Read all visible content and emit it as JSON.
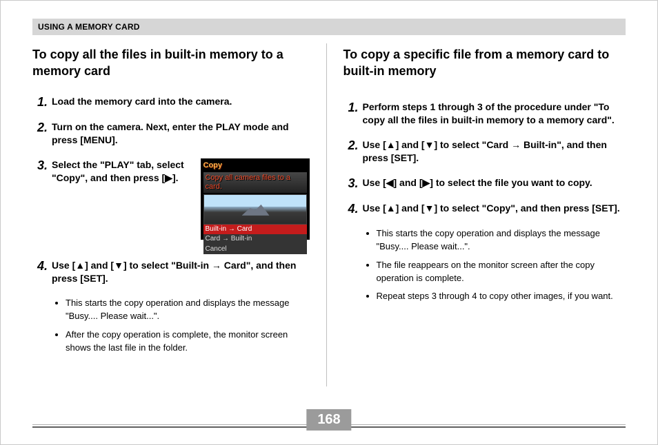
{
  "section_bar": "USING A MEMORY CARD",
  "page_number": "168",
  "left": {
    "heading": "To copy all the files in built-in memory to a memory card",
    "steps": {
      "s1": "Load the memory card into the camera.",
      "s2": "Turn on the camera. Next, enter the PLAY mode and press [MENU].",
      "s3": "Select the \"PLAY\" tab, select \"Copy\", and then press [▶].",
      "s4": "Use [▲] and [▼] to select \"Built-in → Card\", and then press [SET]."
    },
    "s4_sub": [
      "This starts the copy operation and displays the message \"Busy.... Please wait...\".",
      "After the copy operation is complete, the monitor screen shows the last file in the folder."
    ],
    "lcd": {
      "title": "Copy",
      "subtitle": "Copy all camera files to a card.",
      "menu_sel": "Built-in → Card",
      "menu_row1": "Card → Built-in",
      "menu_row2": "Cancel"
    }
  },
  "right": {
    "heading": "To copy a specific file from a memory card to built-in memory",
    "steps": {
      "s1": "Perform steps 1 through 3 of the procedure under \"To copy all the files in built-in memory to a memory card\".",
      "s2": "Use [▲] and [▼] to select \"Card → Built-in\", and then press [SET].",
      "s3": "Use [◀] and [▶] to select the file you want to copy.",
      "s4": "Use [▲] and [▼] to select \"Copy\", and then press [SET]."
    },
    "s4_sub": [
      "This starts the copy operation and displays the message \"Busy.... Please wait...\".",
      "The file reappears on the monitor screen after the copy operation is complete.",
      "Repeat steps 3 through 4 to copy other images, if you want."
    ]
  }
}
